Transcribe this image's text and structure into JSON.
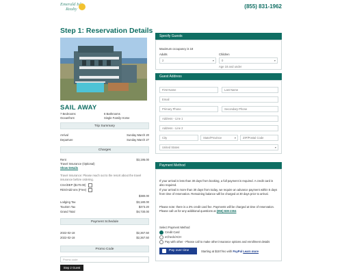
{
  "header": {
    "logo_line1": "Emerald Isle",
    "logo_line2": "Realty",
    "phone": "(855) 831-1962"
  },
  "page_title": "Step 1: Reservation Details",
  "property": {
    "name": "SAIL AWAY",
    "bedrooms": "7 Bedrooms",
    "bathrooms": "6 Bathrooms",
    "location": "Oceanfront",
    "type": "Single Family Home"
  },
  "trip_summary": {
    "header": "Trip Summary",
    "arrival_label": "Arrival",
    "arrival_value": "Sunday March 20",
    "departure_label": "Departure",
    "departure_value": "Sunday March 27"
  },
  "charges": {
    "header": "Charges",
    "rent_label": "Rent",
    "rent_value": "$3,195.00",
    "protection_label": "Travel Insurance (Optional)",
    "show_details": "Show Details",
    "note": "Travel Insurance: Please reach out to the resort about the travel insurance before ordering.",
    "option1": "CSA/DEP ($170.00)",
    "option2": "RDS/Add-ons (Free)",
    "subtotal_value": "$380.00",
    "lodging_tax_label": "Lodging Tax",
    "lodging_tax_value": "$3,180.00",
    "tourism_tax_label": "Tourism Tax",
    "tourism_tax_value": "$473.20",
    "grand_total_label": "Grand Total",
    "grand_total_value": "$4,730.00"
  },
  "payment_schedule": {
    "header": "Payment Schedule",
    "rows": [
      {
        "date": "2022-02-18",
        "amount": "$2,367.50"
      },
      {
        "date": "2022-02-18",
        "amount": "$2,367.50"
      }
    ]
  },
  "promo": {
    "header": "Promo Code",
    "placeholder": "Promo code",
    "submit_label": "Step 2 Guest Details"
  },
  "guests": {
    "header": "Specify Guests",
    "note": "Maximum occupancy is 18",
    "adults_label": "Adults",
    "adults_value": "2",
    "children_label": "Children",
    "children_value": "0",
    "children_note": "Age 18 and under"
  },
  "address": {
    "header": "Guest Address",
    "first_name": "First Name",
    "last_name": "Last Name",
    "email": "Email",
    "primary_phone": "Primary Phone",
    "secondary_phone": "Secondary Phone",
    "address1": "Address - Line 1",
    "address2": "Address - Line 2",
    "city": "City",
    "state": "State/Province",
    "zip": "ZIP/Postal Code",
    "country": "United States"
  },
  "payment": {
    "header": "Payment Method",
    "p1": "If your arrival is less than 30 days from booking, a full payment is required. A credit card is also required.",
    "p2": "If your arrival is more than 30 days from today, we require an advance payment within 5 days from time of reservation. Remaining balance will be charged at 30 days prior to arrival.",
    "p3": "Please note: there is a 3% credit card fee. Payments will be charged at time of reservation. Please call us for any additional questions at",
    "phone_link": "(855) 828-2304",
    "select_label": "Select Payment Method",
    "methods": [
      "Credit Card",
      "eCheck/ACH",
      "Pay with other - Please call to make other insurance options and enrollment details"
    ],
    "paypal_label": "Pay over time",
    "paypal_note": "Starting at $157/mo with",
    "learn_more": "Learn more"
  },
  "colors": {
    "accent": "#0f6e63",
    "header_bg": "#0f6e63",
    "paypal": "#1d3f8f"
  }
}
